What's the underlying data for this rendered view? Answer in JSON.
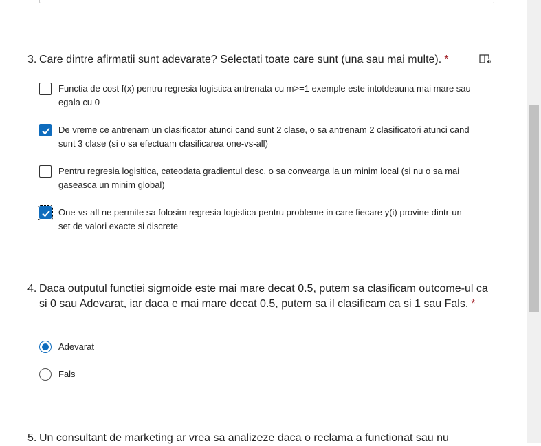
{
  "q3": {
    "number": "3.",
    "title": "Care dintre afirmatii sunt adevarate? Selectati toate care sunt (una sau mai multe).",
    "required_mark": "*",
    "icon": "immersive-reader-icon",
    "options": [
      {
        "label": "Functia de cost f(x) pentru regresia logistica antrenata cu m>=1 exemple este intotdeauna mai mare sau egala cu 0",
        "checked": false
      },
      {
        "label": "De vreme ce antrenam un clasificator atunci cand sunt 2 clase, o sa antrenam 2 clasificatori atunci cand sunt 3 clase (si o sa efectuam clasificarea one-vs-all)",
        "checked": true
      },
      {
        "label": "Pentru regresia logisitica, cateodata gradientul desc. o sa convearga la un minim local (si nu o sa mai gaseasca un minim global)",
        "checked": false
      },
      {
        "label": "One-vs-all ne permite sa folosim regresia logistica pentru probleme in care fiecare y(i) provine dintr-un set de valori exacte si discrete",
        "checked": true
      }
    ]
  },
  "q4": {
    "number": "4.",
    "title": "Daca outputul functiei sigmoide este mai mare decat 0.5, putem sa clasificam outcome-ul ca si 0 sau Adevarat, iar daca e mai mare decat 0.5, putem sa il clasificam ca si 1 sau Fals.",
    "required_mark": "*",
    "options": [
      {
        "label": "Adevarat",
        "selected": true
      },
      {
        "label": "Fals",
        "selected": false
      }
    ]
  },
  "q5": {
    "number": "5.",
    "title": "Un consultant de marketing ar vrea sa analizeze daca o reclama a functionat sau nu"
  },
  "colors": {
    "accent": "#0f6cbd",
    "required": "#a4262c"
  }
}
